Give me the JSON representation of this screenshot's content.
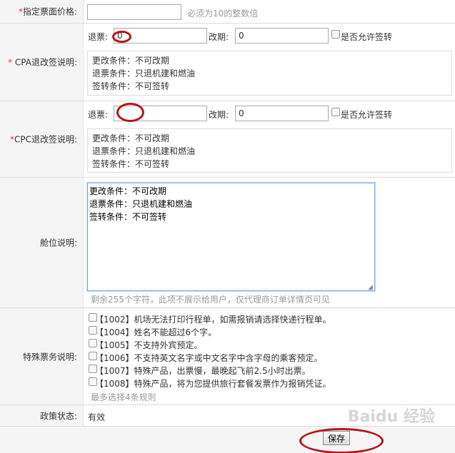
{
  "price": {
    "label": "指定票面价格:",
    "required_mark": "*",
    "value": "",
    "hint": "必须为10的整数倍"
  },
  "cpa": {
    "label": "CPA退改签说明:",
    "required_mark": "*",
    "refund_label": "退票:",
    "refund_value": "0",
    "change_label": "改期:",
    "change_value": "0",
    "endorse_label": "是否允许签转",
    "lines": [
      "更改条件：不可改期",
      "退票条件：只退机建和燃油",
      "签转条件：不可签转"
    ]
  },
  "cpc": {
    "label": "CPC退改签说明:",
    "required_mark": "*",
    "refund_label": "退票:",
    "refund_value": "",
    "change_label": "改期:",
    "change_value": "0",
    "endorse_label": "是否允许签转",
    "lines": [
      "更改条件：不可改期",
      "退票条件：只退机建和燃油",
      "签转条件：不可签转"
    ]
  },
  "cabin": {
    "label": "舱位说明:",
    "text": "更改条件：不可改期\n退票条件：只退机建和燃油\n签转条件：不可签转",
    "hint": "剩余255个字符，此项不展示给用户，仅代理商订单详情页可见"
  },
  "special": {
    "label": "特殊票务说明:",
    "options": [
      "【1002】机场无法打印行程单，如需报销请选择快递行程单。",
      "【1004】姓名不能超过6个字。",
      "【1005】不支持外宾预定。",
      "【1006】不支持英文名字或中文名字中含字母的乘客预定。",
      "【1007】特殊产品，出票慢，最晚起飞前2.5小时出票。",
      "【1008】特殊产品，将为您提供旅行套餐发票作为报销凭证。"
    ],
    "hint": "最多选择4条规则"
  },
  "status": {
    "label": "政策状态:",
    "value": "有效"
  },
  "save_label": "保存",
  "watermark": "Baidu 经验",
  "colors": {
    "required": "#ee3333",
    "annotation": "#b5141a",
    "textarea_border": "#7fa6e0"
  }
}
